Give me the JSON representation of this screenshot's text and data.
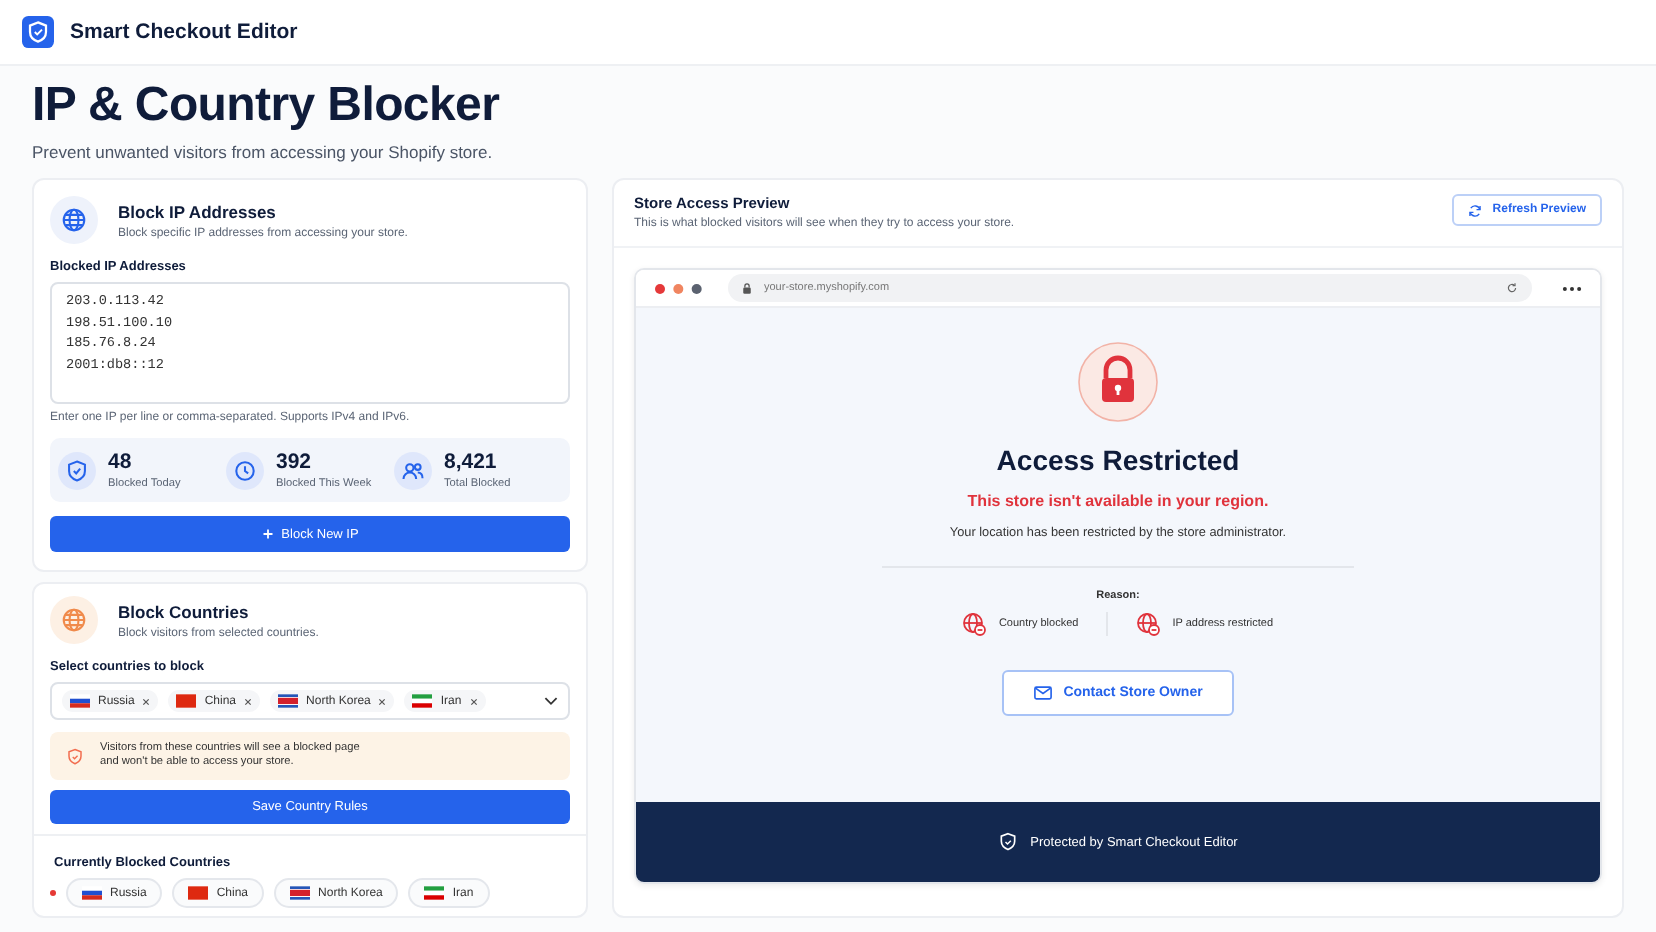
{
  "app": {
    "name": "Smart Checkout Editor"
  },
  "page": {
    "title": "IP & Country Blocker",
    "subtitle": "Prevent unwanted visitors from accessing your Shopify store."
  },
  "ip_card": {
    "title": "Block IP Addresses",
    "subtitle": "Block specific IP addresses from accessing your store.",
    "field_label": "Blocked IP Addresses",
    "ips": [
      "203.0.113.42",
      "198.51.100.10",
      "185.76.8.24",
      "2001:db8::12"
    ],
    "hint": "Enter one IP per line or comma-separated. Supports IPv4 and IPv6.",
    "stats": [
      {
        "kind": "shield",
        "value": "48",
        "label": "Blocked Today"
      },
      {
        "kind": "clock",
        "value": "392",
        "label": "Blocked This Week"
      },
      {
        "kind": "users",
        "value": "8,421",
        "label": "Total Blocked"
      }
    ],
    "button": "Block New IP"
  },
  "country_card": {
    "title": "Block Countries",
    "subtitle": "Block visitors from selected countries.",
    "field_label": "Select countries to block",
    "selected": [
      {
        "name": "Russia",
        "kind": "ru"
      },
      {
        "name": "China",
        "kind": "cn"
      },
      {
        "name": "North Korea",
        "kind": "kp"
      },
      {
        "name": "Iran",
        "kind": "ir"
      }
    ],
    "warning": [
      "Visitors from these countries will see a blocked page",
      "and won't be able to access your store."
    ],
    "button": "Save Country Rules",
    "current_title": "Currently Blocked Countries",
    "current": [
      {
        "name": "Russia",
        "kind": "ru"
      },
      {
        "name": "China",
        "kind": "cn"
      },
      {
        "name": "North Korea",
        "kind": "kp"
      },
      {
        "name": "Iran",
        "kind": "ir"
      }
    ]
  },
  "preview": {
    "title": "Store Access Preview",
    "subtitle": "This is what blocked visitors will see when they try to access your store.",
    "refresh_button": "Refresh Preview",
    "url": "your-store.myshopify.com",
    "heading": "Access Restricted",
    "alert": "This store isn't available in your region.",
    "message": "Your location has been restricted by the store administrator.",
    "reason_label": "Reason:",
    "reasons": [
      "Country blocked",
      "IP address restricted"
    ],
    "contact_button": "Contact Store Owner",
    "footer": "Protected by Smart Checkout Editor"
  }
}
